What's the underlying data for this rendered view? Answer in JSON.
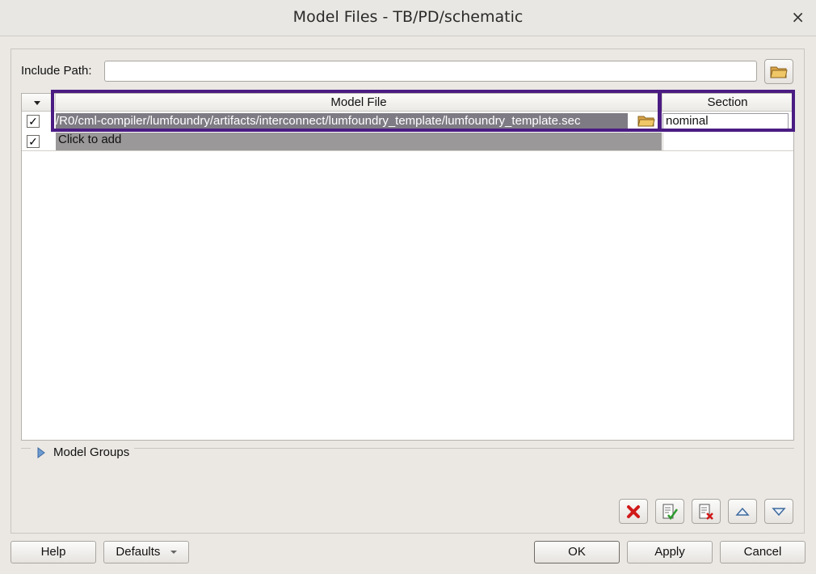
{
  "window": {
    "title": "Model Files - TB/PD/schematic",
    "close_glyph": "×"
  },
  "include_path": {
    "label": "Include Path:",
    "value": ""
  },
  "table": {
    "columns": [
      "",
      "Model File",
      "Section"
    ],
    "rows": [
      {
        "checked": true,
        "check_glyph": "✓",
        "model_file": "/R0/cml-compiler/lumfoundry/artifacts/interconnect/lumfoundry_template/lumfoundry_template.sec",
        "section": "nominal"
      },
      {
        "checked": true,
        "check_glyph": "✓",
        "model_file": "Click to add",
        "section": ""
      }
    ]
  },
  "model_groups": {
    "label": "Model Groups",
    "expanded": false
  },
  "toolbar_icons": [
    "delete-icon",
    "enable-all-icon",
    "disable-all-icon",
    "move-up-icon",
    "move-down-icon"
  ],
  "buttons": {
    "help": "Help",
    "defaults": "Defaults",
    "ok": "OK",
    "apply": "Apply",
    "cancel": "Cancel"
  },
  "colors": {
    "selection": "#7f7b84",
    "highlight": "#4b1c83",
    "add_row": "#9a9898",
    "delete_red": "#d11a1a"
  }
}
